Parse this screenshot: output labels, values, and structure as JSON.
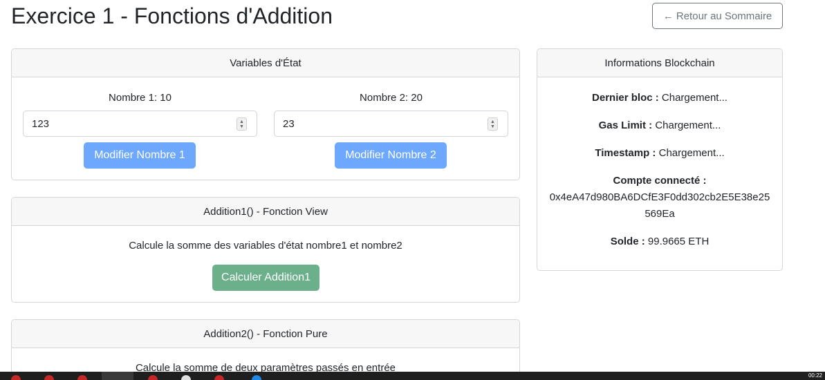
{
  "header": {
    "title": "Exercice 1 - Fonctions d'Addition",
    "back_label": "← Retour au Sommaire"
  },
  "state_vars": {
    "title": "Variables d'État",
    "nombre1_label": "Nombre 1: 10",
    "nombre1_value": "123",
    "nombre1_button": "Modifier Nombre 1",
    "nombre2_label": "Nombre 2: 20",
    "nombre2_value": "23",
    "nombre2_button": "Modifier Nombre 2"
  },
  "addition1": {
    "title": "Addition1() - Fonction View",
    "description": "Calcule la somme des variables d'état nombre1 et nombre2",
    "button": "Calculer Addition1"
  },
  "addition2": {
    "title": "Addition2() - Fonction Pure",
    "description": "Calcule la somme de deux paramètres passés en entrée"
  },
  "blockchain": {
    "title": "Informations Blockchain",
    "last_block_label": "Dernier bloc :",
    "last_block_value": "Chargement...",
    "gas_limit_label": "Gas Limit :",
    "gas_limit_value": "Chargement...",
    "timestamp_label": "Timestamp :",
    "timestamp_value": "Chargement...",
    "account_label": "Compte connecté :",
    "account_line1": "0x4eA47d980BA6DCfE3F0dd302cb2E5E38e25",
    "account_line2": "569Ea",
    "balance_label": "Solde :",
    "balance_value": "99.9665 ETH"
  },
  "taskbar": {
    "clock": "00:22"
  },
  "colors": {
    "primary_button": "#6ea8fe",
    "success_button": "#6bb08a",
    "card_header_bg": "#f7f7f7",
    "taskbar_bg": "#1f1f1f"
  }
}
